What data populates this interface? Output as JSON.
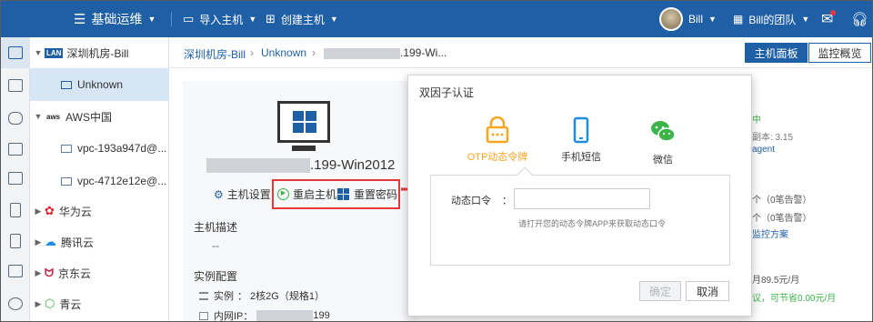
{
  "topbar": {
    "menu_title": "基础运维",
    "import_host": "导入主机",
    "create_host": "创建主机",
    "user_name": "Bill",
    "team_name": "Bill的团队"
  },
  "tree": {
    "items": [
      {
        "label": "深圳机房-Bill",
        "badge": "LAN"
      },
      {
        "label": "Unknown"
      },
      {
        "label": "AWS中国",
        "badge": "aws"
      },
      {
        "label": "vpc-193a947d@..."
      },
      {
        "label": "vpc-4712e12e@..."
      },
      {
        "label": "华为云"
      },
      {
        "label": "腾讯云"
      },
      {
        "label": "京东云"
      },
      {
        "label": "青云"
      }
    ]
  },
  "breadcrumb": {
    "part1": "深圳机房-Bill",
    "part2": "Unknown",
    "part3": ".199-Wi..."
  },
  "view_buttons": {
    "host_panel": "主机面板",
    "monitor_overview": "监控概览"
  },
  "host": {
    "name_suffix": ".199-Win2012",
    "settings": "主机设置",
    "restart": "重启主机",
    "reset_password": "重置密码",
    "desc_label": "主机描述",
    "desc_value": "--",
    "config_label": "实例配置",
    "instance_label": "实例",
    "instance_value": "：  2核2G（规格1）",
    "ip_label": "内网IP：",
    "ip_suffix": "199"
  },
  "right_peek": {
    "l1": "中",
    "l2": "副本: 3.15",
    "l3": "agent",
    "l4": "个（0笔告警）",
    "l5": "个（0笔告警）",
    "l6": "监控方案",
    "l7": "月89.5元/月",
    "l8": "议，可节省0.00元/月"
  },
  "modal": {
    "title": "双因子认证",
    "tabs": [
      "OTP动态令牌",
      "手机短信",
      "微信"
    ],
    "field_label": "动态口令",
    "field_colon": "：",
    "field_value": "",
    "hint": "请打开您的动态令牌APP来获取动态口令",
    "confirm": "确定",
    "cancel": "取消"
  },
  "colors": {
    "brand": "#1f5fa6",
    "otp_active": "#f5a623",
    "wechat": "#3bb54a",
    "phone": "#1f8ee0",
    "highlight": "#e8373a"
  }
}
